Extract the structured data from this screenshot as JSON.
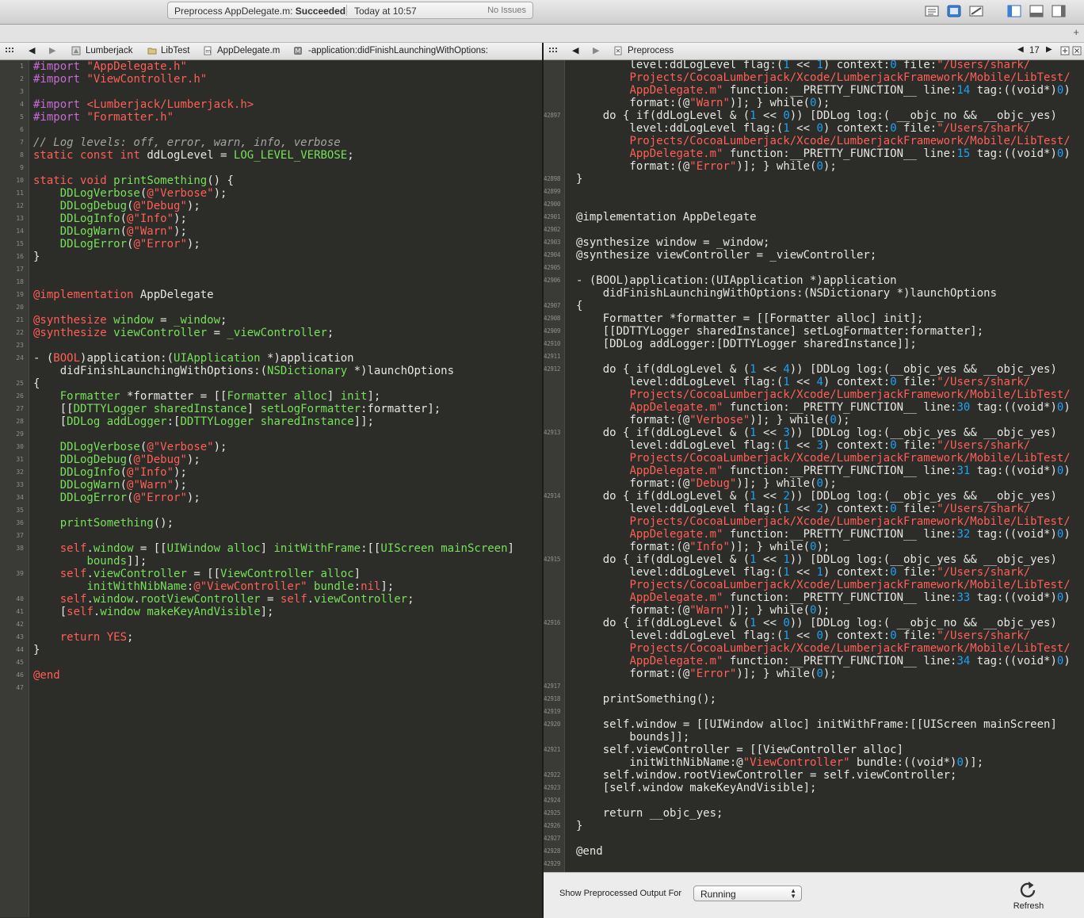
{
  "toolbar": {
    "activity_prefix": "Preprocess AppDelegate.m:",
    "activity_status": "Succeeded",
    "activity_time": "Today at 10:57",
    "activity_issues": "No Issues"
  },
  "left_jumpbar": {
    "crumbs": [
      "Lumberjack",
      "LibTest",
      "AppDelegate.m",
      "-application:didFinishLaunchingWithOptions:"
    ]
  },
  "right_jumpbar": {
    "crumbs": [
      "Preprocess"
    ],
    "counter": "17"
  },
  "left_editor": {
    "gutter": [
      "1",
      "2",
      "3",
      "4",
      "5",
      "6",
      "7",
      "8",
      "9",
      "10",
      "11",
      "12",
      "13",
      "14",
      "15",
      "16",
      "17",
      "18",
      "19",
      "20",
      "21",
      "22",
      "23",
      "24",
      "",
      "25",
      "26",
      "27",
      "28",
      "29",
      "30",
      "31",
      "32",
      "33",
      "34",
      "35",
      "36",
      "37",
      "38",
      "",
      "39",
      "",
      "40",
      "41",
      "42",
      "43",
      "44",
      "45",
      "46",
      "47"
    ],
    "code": [
      "#import \"AppDelegate.h\"",
      "#import \"ViewController.h\"",
      "",
      "#import <Lumberjack/Lumberjack.h>",
      "#import \"Formatter.h\"",
      "",
      "// Log levels: off, error, warn, info, verbose",
      "static const int ddLogLevel = LOG_LEVEL_VERBOSE;",
      "",
      "static void printSomething() {",
      "    DDLogVerbose(@\"Verbose\");",
      "    DDLogDebug(@\"Debug\");",
      "    DDLogInfo(@\"Info\");",
      "    DDLogWarn(@\"Warn\");",
      "    DDLogError(@\"Error\");",
      "}",
      "",
      "",
      "@implementation AppDelegate",
      "",
      "@synthesize window = _window;",
      "@synthesize viewController = _viewController;",
      "",
      "- (BOOL)application:(UIApplication *)application",
      "    didFinishLaunchingWithOptions:(NSDictionary *)launchOptions",
      "{",
      "    Formatter *formatter = [[Formatter alloc] init];",
      "    [[DDTTYLogger sharedInstance] setLogFormatter:formatter];",
      "    [DDLog addLogger:[DDTTYLogger sharedInstance]];",
      "",
      "    DDLogVerbose(@\"Verbose\");",
      "    DDLogDebug(@\"Debug\");",
      "    DDLogInfo(@\"Info\");",
      "    DDLogWarn(@\"Warn\");",
      "    DDLogError(@\"Error\");",
      "",
      "    printSomething();",
      "",
      "    self.window = [[UIWindow alloc] initWithFrame:[[UIScreen mainScreen]",
      "        bounds]];",
      "    self.viewController = [[ViewController alloc]",
      "        initWithNibName:@\"ViewController\" bundle:nil];",
      "    self.window.rootViewController = self.viewController;",
      "    [self.window makeKeyAndVisible];",
      "",
      "    return YES;",
      "}",
      "",
      "@end",
      ""
    ]
  },
  "right_editor": {
    "gutter": [
      "",
      "",
      "",
      "",
      "42897",
      "",
      "",
      "",
      "",
      "42898",
      "42899",
      "42900",
      "42901",
      "42902",
      "42903",
      "42904",
      "42905",
      "42906",
      "",
      "42907",
      "42908",
      "42909",
      "42910",
      "42911",
      "42912",
      "",
      "",
      "",
      "",
      "42913",
      "",
      "",
      "",
      "",
      "42914",
      "",
      "",
      "",
      "",
      "42915",
      "",
      "",
      "",
      "",
      "42916",
      "",
      "",
      "",
      "",
      "42917",
      "42918",
      "42919",
      "42920",
      "",
      "42921",
      "",
      "42922",
      "42923",
      "42924",
      "42925",
      "42926",
      "42927",
      "42928",
      "42929"
    ],
    "code": [
      "        level:ddLogLevel flag:(1 << 1) context:0 file:\"/Users/shark/",
      "        Projects/CocoaLumberjack/Xcode/LumberjackFramework/Mobile/LibTest/",
      "        AppDelegate.m\" function:__PRETTY_FUNCTION__ line:14 tag:((void*)0)",
      "        format:(@\"Warn\")]; } while(0);",
      "    do { if(ddLogLevel & (1 << 0)) [DDLog log:( __objc_no && __objc_yes)",
      "        level:ddLogLevel flag:(1 << 0) context:0 file:\"/Users/shark/",
      "        Projects/CocoaLumberjack/Xcode/LumberjackFramework/Mobile/LibTest/",
      "        AppDelegate.m\" function:__PRETTY_FUNCTION__ line:15 tag:((void*)0)",
      "        format:(@\"Error\")]; } while(0);",
      "}",
      "",
      "",
      "@implementation AppDelegate",
      "",
      "@synthesize window = _window;",
      "@synthesize viewController = _viewController;",
      "",
      "- (BOOL)application:(UIApplication *)application",
      "    didFinishLaunchingWithOptions:(NSDictionary *)launchOptions",
      "{",
      "    Formatter *formatter = [[Formatter alloc] init];",
      "    [[DDTTYLogger sharedInstance] setLogFormatter:formatter];",
      "    [DDLog addLogger:[DDTTYLogger sharedInstance]];",
      "",
      "    do { if(ddLogLevel & (1 << 4)) [DDLog log:(__objc_yes && __objc_yes)",
      "        level:ddLogLevel flag:(1 << 4) context:0 file:\"/Users/shark/",
      "        Projects/CocoaLumberjack/Xcode/LumberjackFramework/Mobile/LibTest/",
      "        AppDelegate.m\" function:__PRETTY_FUNCTION__ line:30 tag:((void*)0)",
      "        format:(@\"Verbose\")]; } while(0);",
      "    do { if(ddLogLevel & (1 << 3)) [DDLog log:(__objc_yes && __objc_yes)",
      "        level:ddLogLevel flag:(1 << 3) context:0 file:\"/Users/shark/",
      "        Projects/CocoaLumberjack/Xcode/LumberjackFramework/Mobile/LibTest/",
      "        AppDelegate.m\" function:__PRETTY_FUNCTION__ line:31 tag:((void*)0)",
      "        format:(@\"Debug\")]; } while(0);",
      "    do { if(ddLogLevel & (1 << 2)) [DDLog log:(__objc_yes && __objc_yes)",
      "        level:ddLogLevel flag:(1 << 2) context:0 file:\"/Users/shark/",
      "        Projects/CocoaLumberjack/Xcode/LumberjackFramework/Mobile/LibTest/",
      "        AppDelegate.m\" function:__PRETTY_FUNCTION__ line:32 tag:((void*)0)",
      "        format:(@\"Info\")]; } while(0);",
      "    do { if(ddLogLevel & (1 << 1)) [DDLog log:(__objc_yes && __objc_yes)",
      "        level:ddLogLevel flag:(1 << 1) context:0 file:\"/Users/shark/",
      "        Projects/CocoaLumberjack/Xcode/LumberjackFramework/Mobile/LibTest/",
      "        AppDelegate.m\" function:__PRETTY_FUNCTION__ line:33 tag:((void*)0)",
      "        format:(@\"Warn\")]; } while(0);",
      "    do { if(ddLogLevel & (1 << 0)) [DDLog log:( __objc_no && __objc_yes)",
      "        level:ddLogLevel flag:(1 << 0) context:0 file:\"/Users/shark/",
      "        Projects/CocoaLumberjack/Xcode/LumberjackFramework/Mobile/LibTest/",
      "        AppDelegate.m\" function:__PRETTY_FUNCTION__ line:34 tag:((void*)0)",
      "        format:(@\"Error\")]; } while(0);",
      "",
      "    printSomething();",
      "",
      "    self.window = [[UIWindow alloc] initWithFrame:[[UIScreen mainScreen]",
      "        bounds]];",
      "    self.viewController = [[ViewController alloc]",
      "        initWithNibName:@\"ViewController\" bundle:((void*)0)];",
      "    self.window.rootViewController = self.viewController;",
      "    [self.window makeKeyAndVisible];",
      "",
      "    return __objc_yes;",
      "}",
      "",
      "@end",
      ""
    ]
  },
  "bottom": {
    "label": "Show Preprocessed Output For",
    "select_value": "Running",
    "refresh_label": "Refresh"
  },
  "colors": {
    "editor_bg": "#2c2c29",
    "string": "#ff5f57",
    "keyword": "#ff5f57",
    "macro": "#77e15a",
    "function": "#e8e44a",
    "number": "#1ea2f1",
    "comment": "#a5a59f"
  },
  "icons": [
    "back-arrow-icon",
    "forward-arrow-icon",
    "project-icon",
    "folder-icon",
    "objc-file-icon",
    "method-icon",
    "related-items-icon",
    "preprocess-doc-icon",
    "refresh-icon",
    "standard-editor-icon",
    "assistant-editor-icon",
    "version-editor-icon",
    "navigator-toggle-icon",
    "debug-toggle-icon",
    "utilities-toggle-icon"
  ]
}
